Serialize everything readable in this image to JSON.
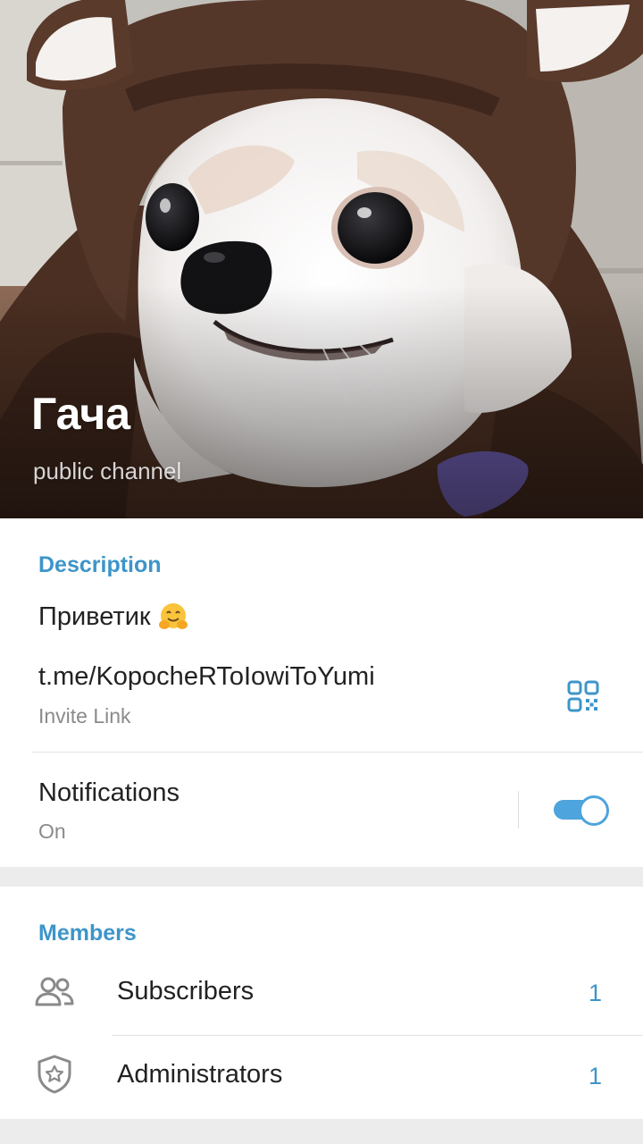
{
  "header": {
    "title": "Гача",
    "subtitle": "public channel"
  },
  "info": {
    "section_title": "Description",
    "description": "Приветик",
    "description_emoji": "hugging-face-emoji",
    "invite_link": "t.me/KopocheRToIowiToYumi",
    "invite_link_caption": "Invite Link",
    "qr_icon": "qr-code-icon",
    "notifications_label": "Notifications",
    "notifications_status": "On",
    "notifications_enabled": true,
    "accent_color": "#3d95c9",
    "toggle_color": "#4ea4dc"
  },
  "members": {
    "section_title": "Members",
    "items": [
      {
        "label": "Subscribers",
        "count": "1",
        "icon": "users-icon"
      },
      {
        "label": "Administrators",
        "count": "1",
        "icon": "shield-star-icon"
      }
    ]
  }
}
